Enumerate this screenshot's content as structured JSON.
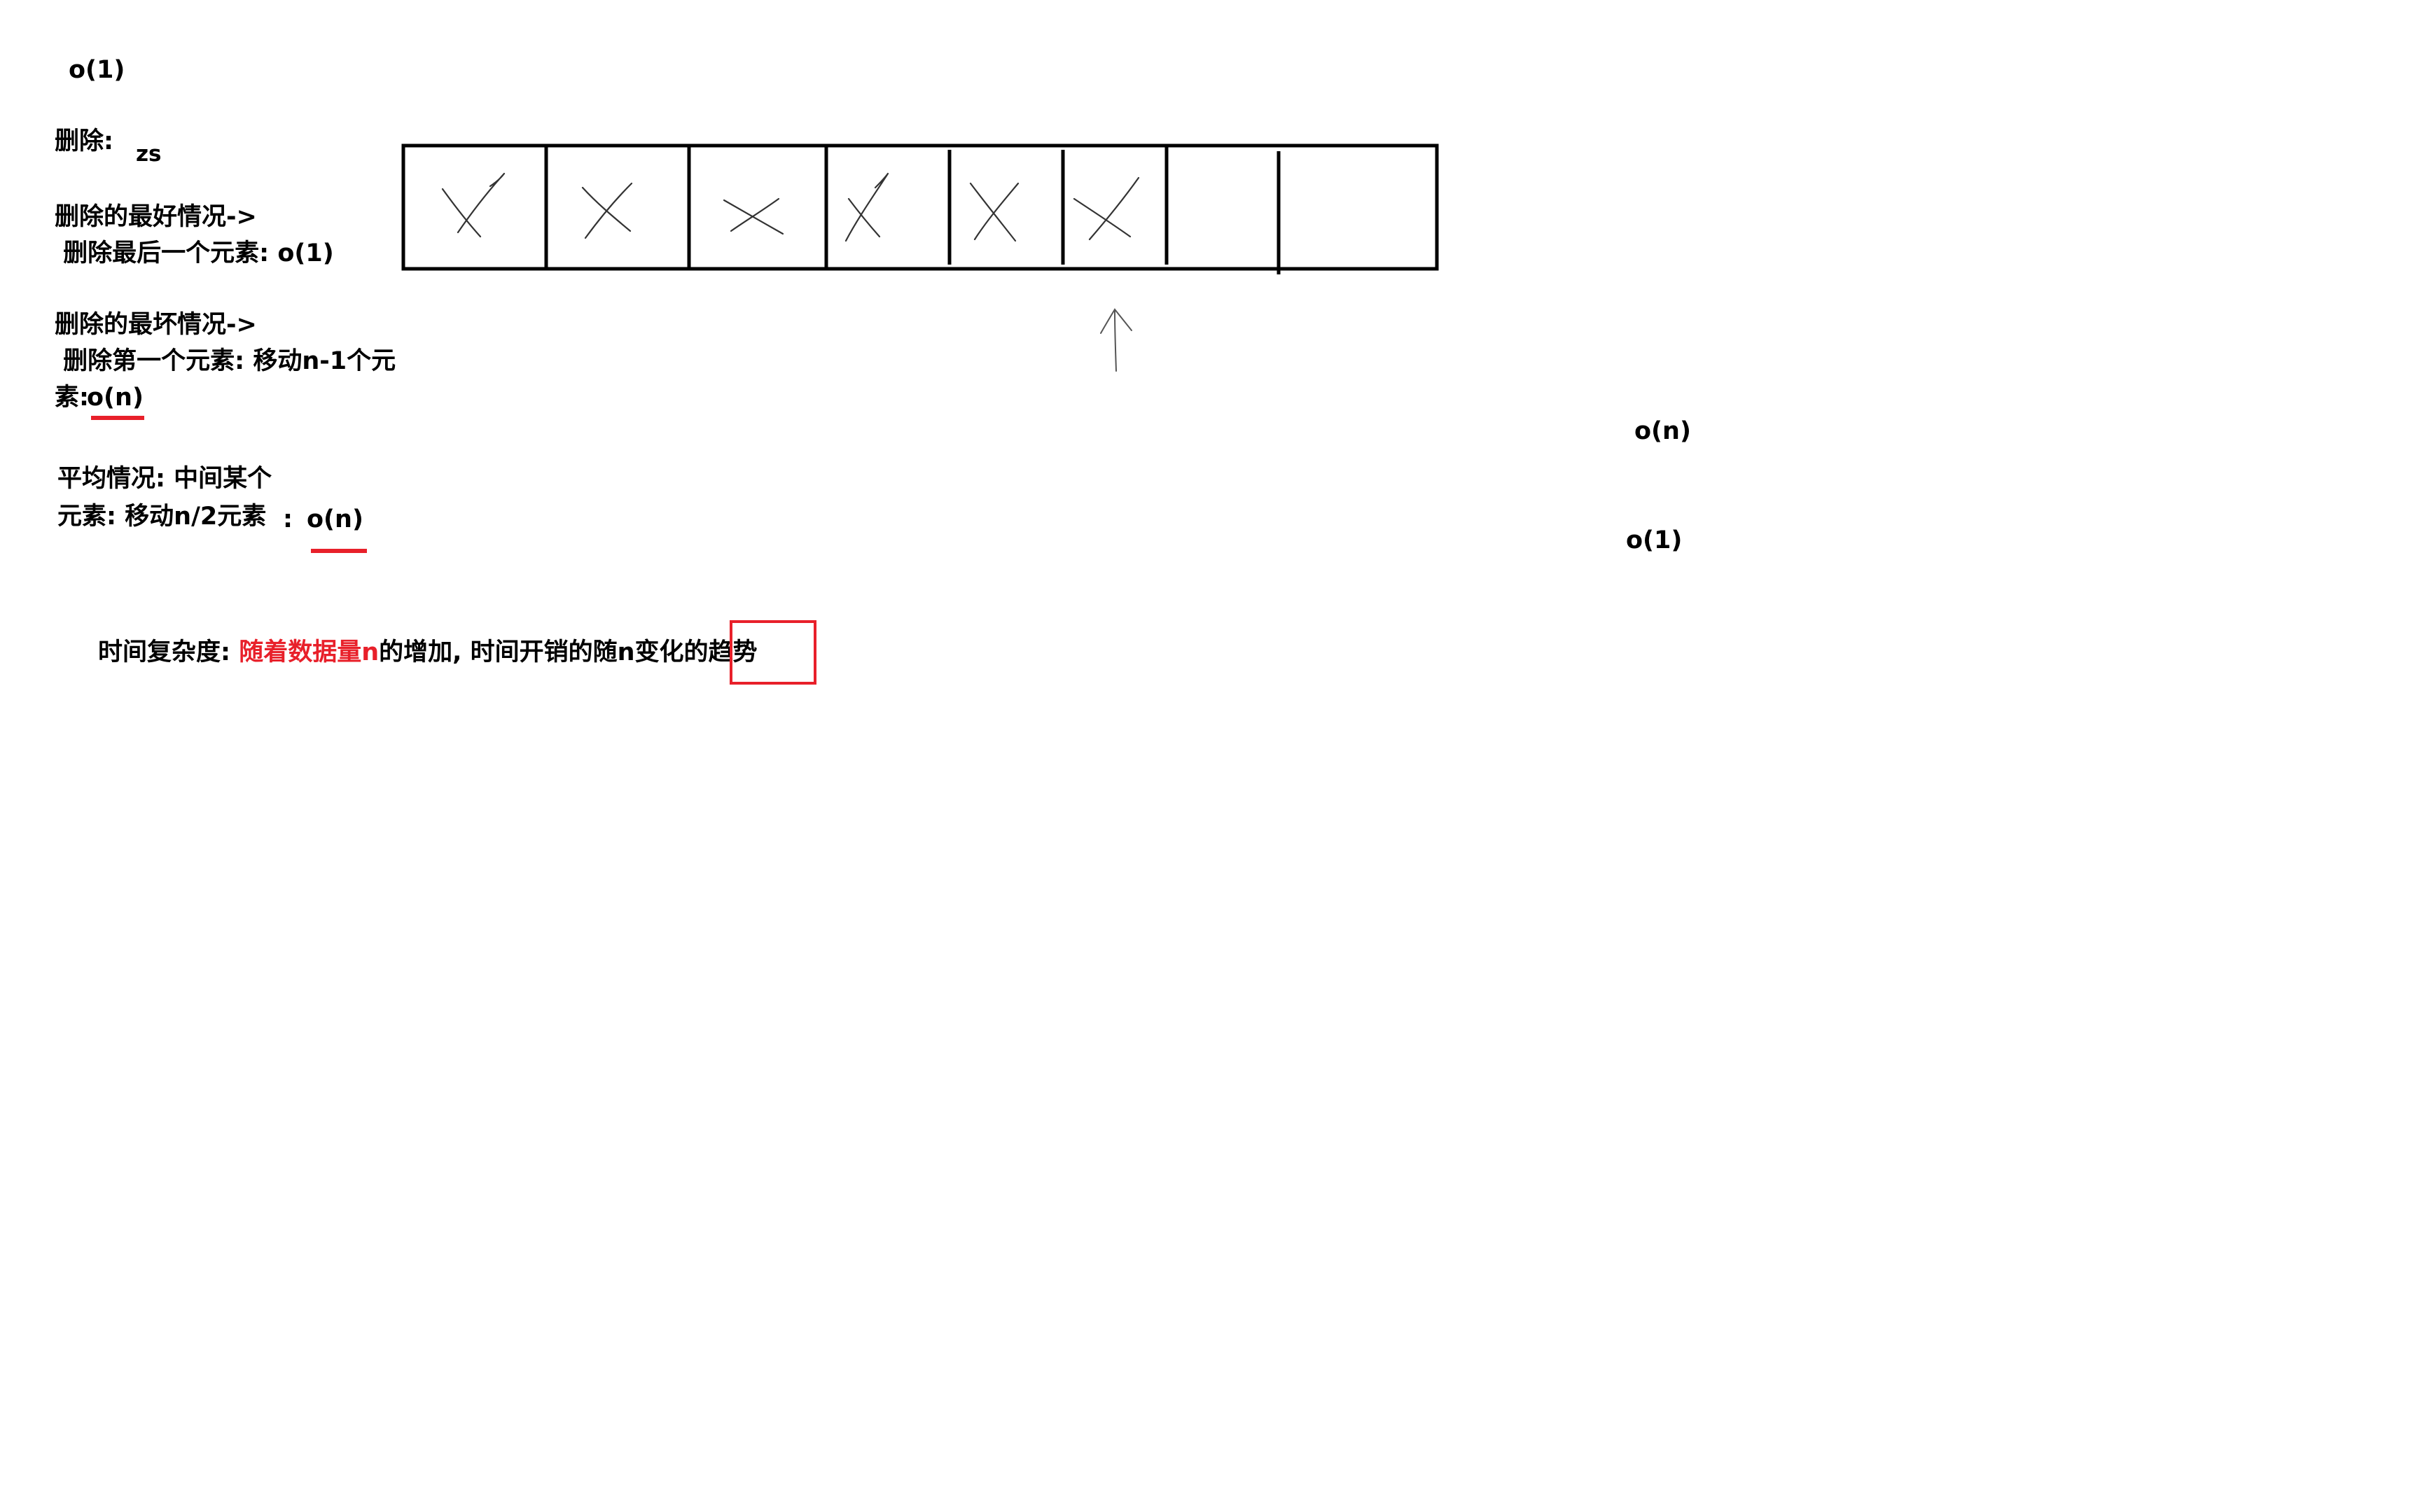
{
  "top_note": "o(1)",
  "delete_label": "删除:",
  "zs_note": "zs",
  "best_case": {
    "line1": "删除的最好情况->",
    "line2": " 删除最后一个元素: o(1)"
  },
  "worst_case": {
    "line1": "删除的最坏情况->",
    "line2": " 删除第一个元素: 移动n-1个元",
    "line3_prefix": "素:",
    "line3_value": "o(n)"
  },
  "average_case": {
    "line1": "平均情况: 中间某个",
    "line2": "元素: 移动n/2元素",
    "colon": ":",
    "value": "o(n)"
  },
  "right_notes": {
    "upper": "o(n)",
    "lower": "o(1)"
  },
  "summary": {
    "prefix": "时间复杂度: ",
    "highlight": "随着数据量n",
    "middle": "的增加, 时间开销的随n变化的",
    "boxed": "趋势"
  },
  "array_diagram": {
    "cell_count": 8,
    "crossed_cells": 6,
    "arrow_points_to_cell": 6
  },
  "colors": {
    "accent_red": "#e8202a",
    "ink": "#000000",
    "background": "#ffffff"
  }
}
